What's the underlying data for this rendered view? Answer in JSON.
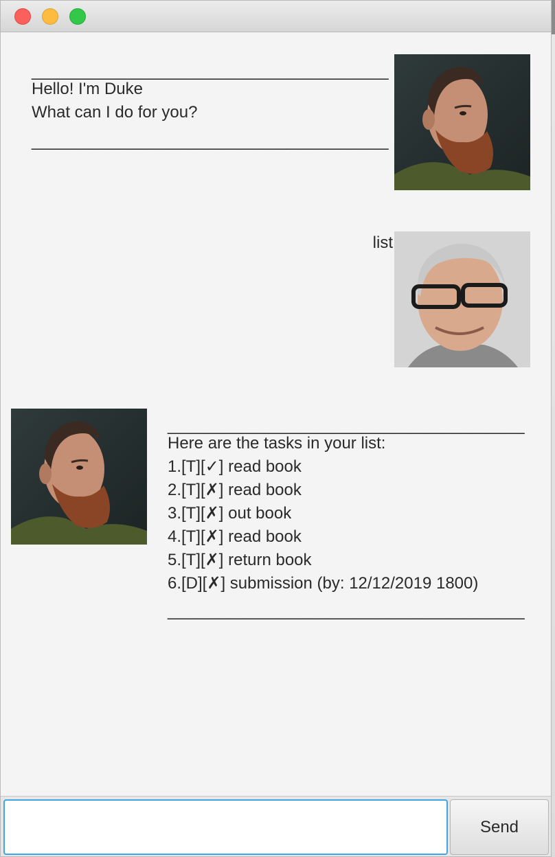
{
  "window": {
    "buttons": [
      "close",
      "minimize",
      "maximize"
    ]
  },
  "messages": [
    {
      "sender": "Duke",
      "divider_top": "__________________________________________",
      "lines": [
        "Hello! I'm Duke",
        "What can I do for you?"
      ],
      "divider_bottom": "__________________________________________"
    },
    {
      "sender": "user",
      "text": "list"
    },
    {
      "sender": "Duke",
      "divider_top": "__________________________________________",
      "lines": [
        "Here are the tasks in your list:",
        "1.[T][✓] read book",
        "2.[T][✗] read book",
        "3.[T][✗] out book",
        "4.[T][✗] read book",
        "5.[T][✗] return book",
        "6.[D][✗] submission (by: 12/12/2019 1800)"
      ],
      "divider_bottom": "__________________________________________"
    }
  ],
  "input": {
    "value": "",
    "placeholder": ""
  },
  "send_button": {
    "label": "Send"
  },
  "colors": {
    "window_bg": "#f4f4f4",
    "input_focus": "#3fa6e6"
  }
}
